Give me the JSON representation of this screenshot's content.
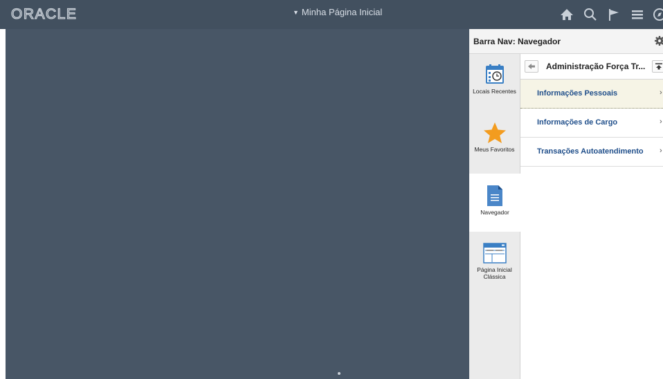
{
  "header": {
    "logo_text": "ORACLE",
    "page_title": "Minha Página Inicial",
    "icons": [
      "home-icon",
      "search-icon",
      "flag-icon",
      "menu-icon",
      "compass-icon"
    ]
  },
  "nav": {
    "title": "Barra Nav: Navegador",
    "tabs": [
      {
        "label": "Locais Recentes",
        "icon": "calendar-clock-icon"
      },
      {
        "label": "Meus Favoritos",
        "icon": "star-icon"
      },
      {
        "label": "Navegador",
        "icon": "document-icon"
      },
      {
        "label_line1": "Página Inicial",
        "label_line2": "Clássica",
        "icon": "classic-home-icon"
      }
    ],
    "breadcrumb": "Administração Força Tr...",
    "items": [
      {
        "label": "Informações Pessoais"
      },
      {
        "label": "Informações de Cargo"
      },
      {
        "label": "Transações Autoatendimento"
      }
    ]
  },
  "colors": {
    "header_bg": "#42505f",
    "main_bg": "#485666",
    "link": "#1f4e8a",
    "star": "#f39c1f",
    "doc_blue": "#4a86c8"
  }
}
